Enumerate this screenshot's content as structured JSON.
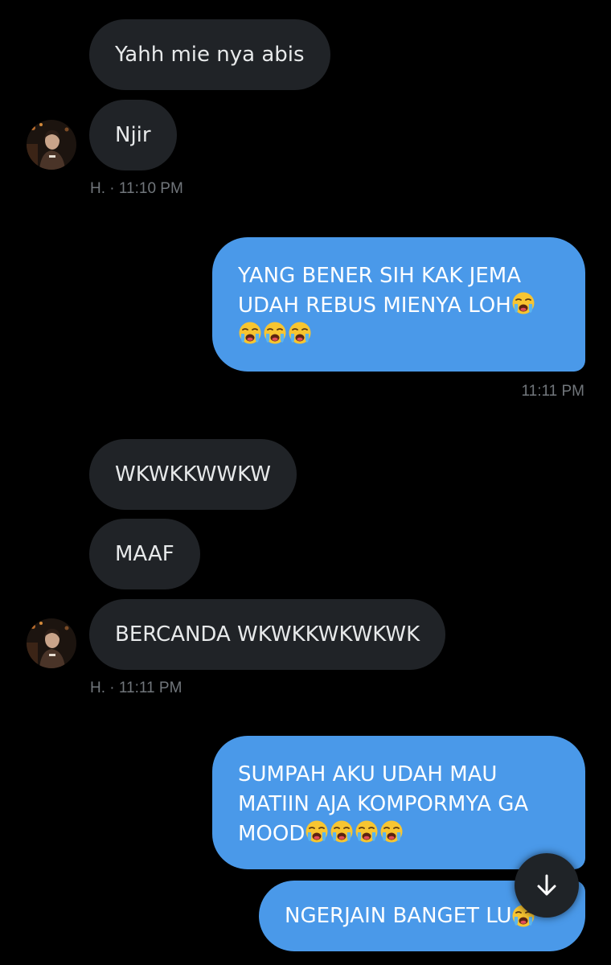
{
  "messages": [
    {
      "text": "Yahh mie nya abis"
    },
    {
      "text": "Njir"
    },
    {
      "meta": "H. · 11:10 PM"
    },
    {
      "text_line1": "YANG BENER SIH KAK JEMA",
      "text_line2": "UDAH REBUS MIENYA LOH"
    },
    {
      "meta": "11:11 PM"
    },
    {
      "text": "WKWKKWWKW"
    },
    {
      "text": "MAAF"
    },
    {
      "text": "BERCANDA WKWKKWKWKWK"
    },
    {
      "meta": "H. · 11:11 PM"
    },
    {
      "text_line1": "SUMPAH AKU UDAH MAU",
      "text_line2": "MATIIN AJA KOMPORMYA GA",
      "text_line3": "MOOD"
    },
    {
      "text": "NGERJAIN BANGET LU"
    }
  ],
  "emoji": "loudly-crying-face",
  "icons": {
    "avatar": "user-avatar",
    "scroll": "arrow-down-icon"
  },
  "colors": {
    "background": "#000000",
    "incoming_bubble": "#202327",
    "outgoing_bubble": "#4a99e9",
    "meta_text": "#71767b"
  }
}
